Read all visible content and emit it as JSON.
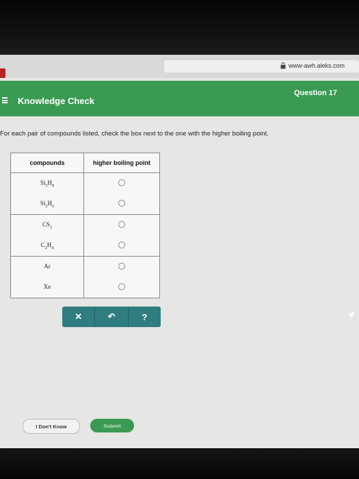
{
  "browser": {
    "url": "www-awh.aleks.com"
  },
  "header": {
    "title": "Knowledge Check",
    "question": "Question 17"
  },
  "prompt": "For each pair of compounds listed, check the box next to the one with the higher boiling point.",
  "table": {
    "headers": [
      "compounds",
      "higher boiling point"
    ],
    "rows": [
      {
        "base": "Si",
        "s1": "3",
        "mid": "H",
        "s2": "8"
      },
      {
        "base": "Si",
        "s1": "2",
        "mid": "H",
        "s2": "6"
      },
      {
        "base": "CS",
        "s1": "2",
        "mid": "",
        "s2": ""
      },
      {
        "base": "C",
        "s1": "2",
        "mid": "H",
        "s2": "4"
      },
      {
        "base": "Ar",
        "s1": "",
        "mid": "",
        "s2": ""
      },
      {
        "base": "Xe",
        "s1": "",
        "mid": "",
        "s2": ""
      }
    ]
  },
  "tools": {
    "clear": "✕",
    "undo": "↶",
    "help": "?"
  },
  "footer": {
    "dont_know": "I Don't Know",
    "submit": "Submit"
  },
  "colors": {
    "header_green": "#3a9a52",
    "tool_teal": "#2f7d80"
  }
}
